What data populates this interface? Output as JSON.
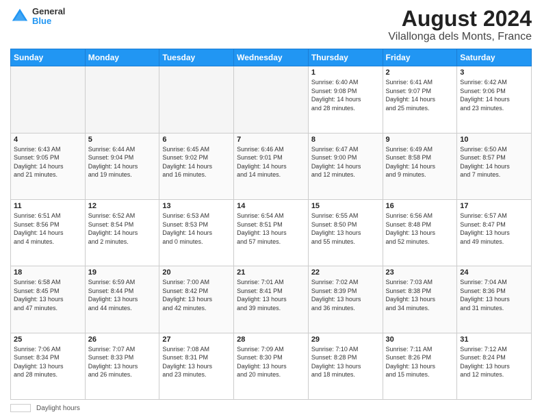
{
  "header": {
    "logo_line1": "General",
    "logo_line2": "Blue",
    "title": "August 2024",
    "subtitle": "Vilallonga dels Monts, France"
  },
  "days_of_week": [
    "Sunday",
    "Monday",
    "Tuesday",
    "Wednesday",
    "Thursday",
    "Friday",
    "Saturday"
  ],
  "weeks": [
    [
      {
        "day": "",
        "info": ""
      },
      {
        "day": "",
        "info": ""
      },
      {
        "day": "",
        "info": ""
      },
      {
        "day": "",
        "info": ""
      },
      {
        "day": "1",
        "info": "Sunrise: 6:40 AM\nSunset: 9:08 PM\nDaylight: 14 hours\nand 28 minutes."
      },
      {
        "day": "2",
        "info": "Sunrise: 6:41 AM\nSunset: 9:07 PM\nDaylight: 14 hours\nand 25 minutes."
      },
      {
        "day": "3",
        "info": "Sunrise: 6:42 AM\nSunset: 9:06 PM\nDaylight: 14 hours\nand 23 minutes."
      }
    ],
    [
      {
        "day": "4",
        "info": "Sunrise: 6:43 AM\nSunset: 9:05 PM\nDaylight: 14 hours\nand 21 minutes."
      },
      {
        "day": "5",
        "info": "Sunrise: 6:44 AM\nSunset: 9:04 PM\nDaylight: 14 hours\nand 19 minutes."
      },
      {
        "day": "6",
        "info": "Sunrise: 6:45 AM\nSunset: 9:02 PM\nDaylight: 14 hours\nand 16 minutes."
      },
      {
        "day": "7",
        "info": "Sunrise: 6:46 AM\nSunset: 9:01 PM\nDaylight: 14 hours\nand 14 minutes."
      },
      {
        "day": "8",
        "info": "Sunrise: 6:47 AM\nSunset: 9:00 PM\nDaylight: 14 hours\nand 12 minutes."
      },
      {
        "day": "9",
        "info": "Sunrise: 6:49 AM\nSunset: 8:58 PM\nDaylight: 14 hours\nand 9 minutes."
      },
      {
        "day": "10",
        "info": "Sunrise: 6:50 AM\nSunset: 8:57 PM\nDaylight: 14 hours\nand 7 minutes."
      }
    ],
    [
      {
        "day": "11",
        "info": "Sunrise: 6:51 AM\nSunset: 8:56 PM\nDaylight: 14 hours\nand 4 minutes."
      },
      {
        "day": "12",
        "info": "Sunrise: 6:52 AM\nSunset: 8:54 PM\nDaylight: 14 hours\nand 2 minutes."
      },
      {
        "day": "13",
        "info": "Sunrise: 6:53 AM\nSunset: 8:53 PM\nDaylight: 14 hours\nand 0 minutes."
      },
      {
        "day": "14",
        "info": "Sunrise: 6:54 AM\nSunset: 8:51 PM\nDaylight: 13 hours\nand 57 minutes."
      },
      {
        "day": "15",
        "info": "Sunrise: 6:55 AM\nSunset: 8:50 PM\nDaylight: 13 hours\nand 55 minutes."
      },
      {
        "day": "16",
        "info": "Sunrise: 6:56 AM\nSunset: 8:48 PM\nDaylight: 13 hours\nand 52 minutes."
      },
      {
        "day": "17",
        "info": "Sunrise: 6:57 AM\nSunset: 8:47 PM\nDaylight: 13 hours\nand 49 minutes."
      }
    ],
    [
      {
        "day": "18",
        "info": "Sunrise: 6:58 AM\nSunset: 8:45 PM\nDaylight: 13 hours\nand 47 minutes."
      },
      {
        "day": "19",
        "info": "Sunrise: 6:59 AM\nSunset: 8:44 PM\nDaylight: 13 hours\nand 44 minutes."
      },
      {
        "day": "20",
        "info": "Sunrise: 7:00 AM\nSunset: 8:42 PM\nDaylight: 13 hours\nand 42 minutes."
      },
      {
        "day": "21",
        "info": "Sunrise: 7:01 AM\nSunset: 8:41 PM\nDaylight: 13 hours\nand 39 minutes."
      },
      {
        "day": "22",
        "info": "Sunrise: 7:02 AM\nSunset: 8:39 PM\nDaylight: 13 hours\nand 36 minutes."
      },
      {
        "day": "23",
        "info": "Sunrise: 7:03 AM\nSunset: 8:38 PM\nDaylight: 13 hours\nand 34 minutes."
      },
      {
        "day": "24",
        "info": "Sunrise: 7:04 AM\nSunset: 8:36 PM\nDaylight: 13 hours\nand 31 minutes."
      }
    ],
    [
      {
        "day": "25",
        "info": "Sunrise: 7:06 AM\nSunset: 8:34 PM\nDaylight: 13 hours\nand 28 minutes."
      },
      {
        "day": "26",
        "info": "Sunrise: 7:07 AM\nSunset: 8:33 PM\nDaylight: 13 hours\nand 26 minutes."
      },
      {
        "day": "27",
        "info": "Sunrise: 7:08 AM\nSunset: 8:31 PM\nDaylight: 13 hours\nand 23 minutes."
      },
      {
        "day": "28",
        "info": "Sunrise: 7:09 AM\nSunset: 8:30 PM\nDaylight: 13 hours\nand 20 minutes."
      },
      {
        "day": "29",
        "info": "Sunrise: 7:10 AM\nSunset: 8:28 PM\nDaylight: 13 hours\nand 18 minutes."
      },
      {
        "day": "30",
        "info": "Sunrise: 7:11 AM\nSunset: 8:26 PM\nDaylight: 13 hours\nand 15 minutes."
      },
      {
        "day": "31",
        "info": "Sunrise: 7:12 AM\nSunset: 8:24 PM\nDaylight: 13 hours\nand 12 minutes."
      }
    ]
  ],
  "footer": {
    "legend_label": "Daylight hours"
  }
}
